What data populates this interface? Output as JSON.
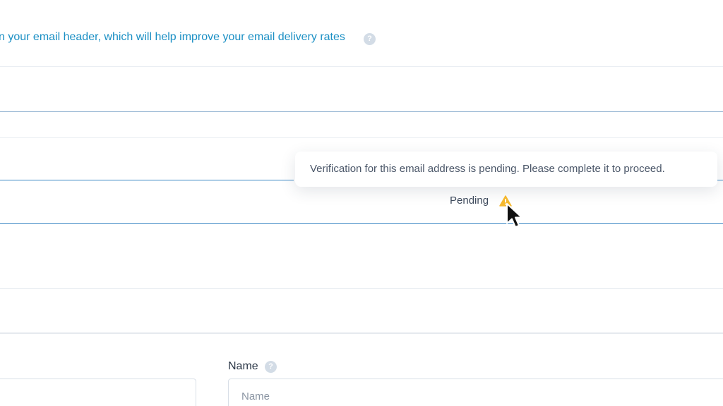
{
  "header": {
    "info_text": "n your email header, which will help improve your email delivery rates",
    "help_icon_glyph": "?"
  },
  "verification": {
    "tooltip_text": "Verification for this email address is pending. Please complete it to proceed.",
    "status_label": "Pending",
    "status_icon": "warning-triangle",
    "status_color": "#f5b82e"
  },
  "form": {
    "name_label": "Name",
    "name_help_glyph": "?",
    "name_placeholder": "Name",
    "name_value": ""
  },
  "colors": {
    "link": "#1a8fc4",
    "accent_line": "#3b87c4",
    "text": "#3e4a5c"
  }
}
